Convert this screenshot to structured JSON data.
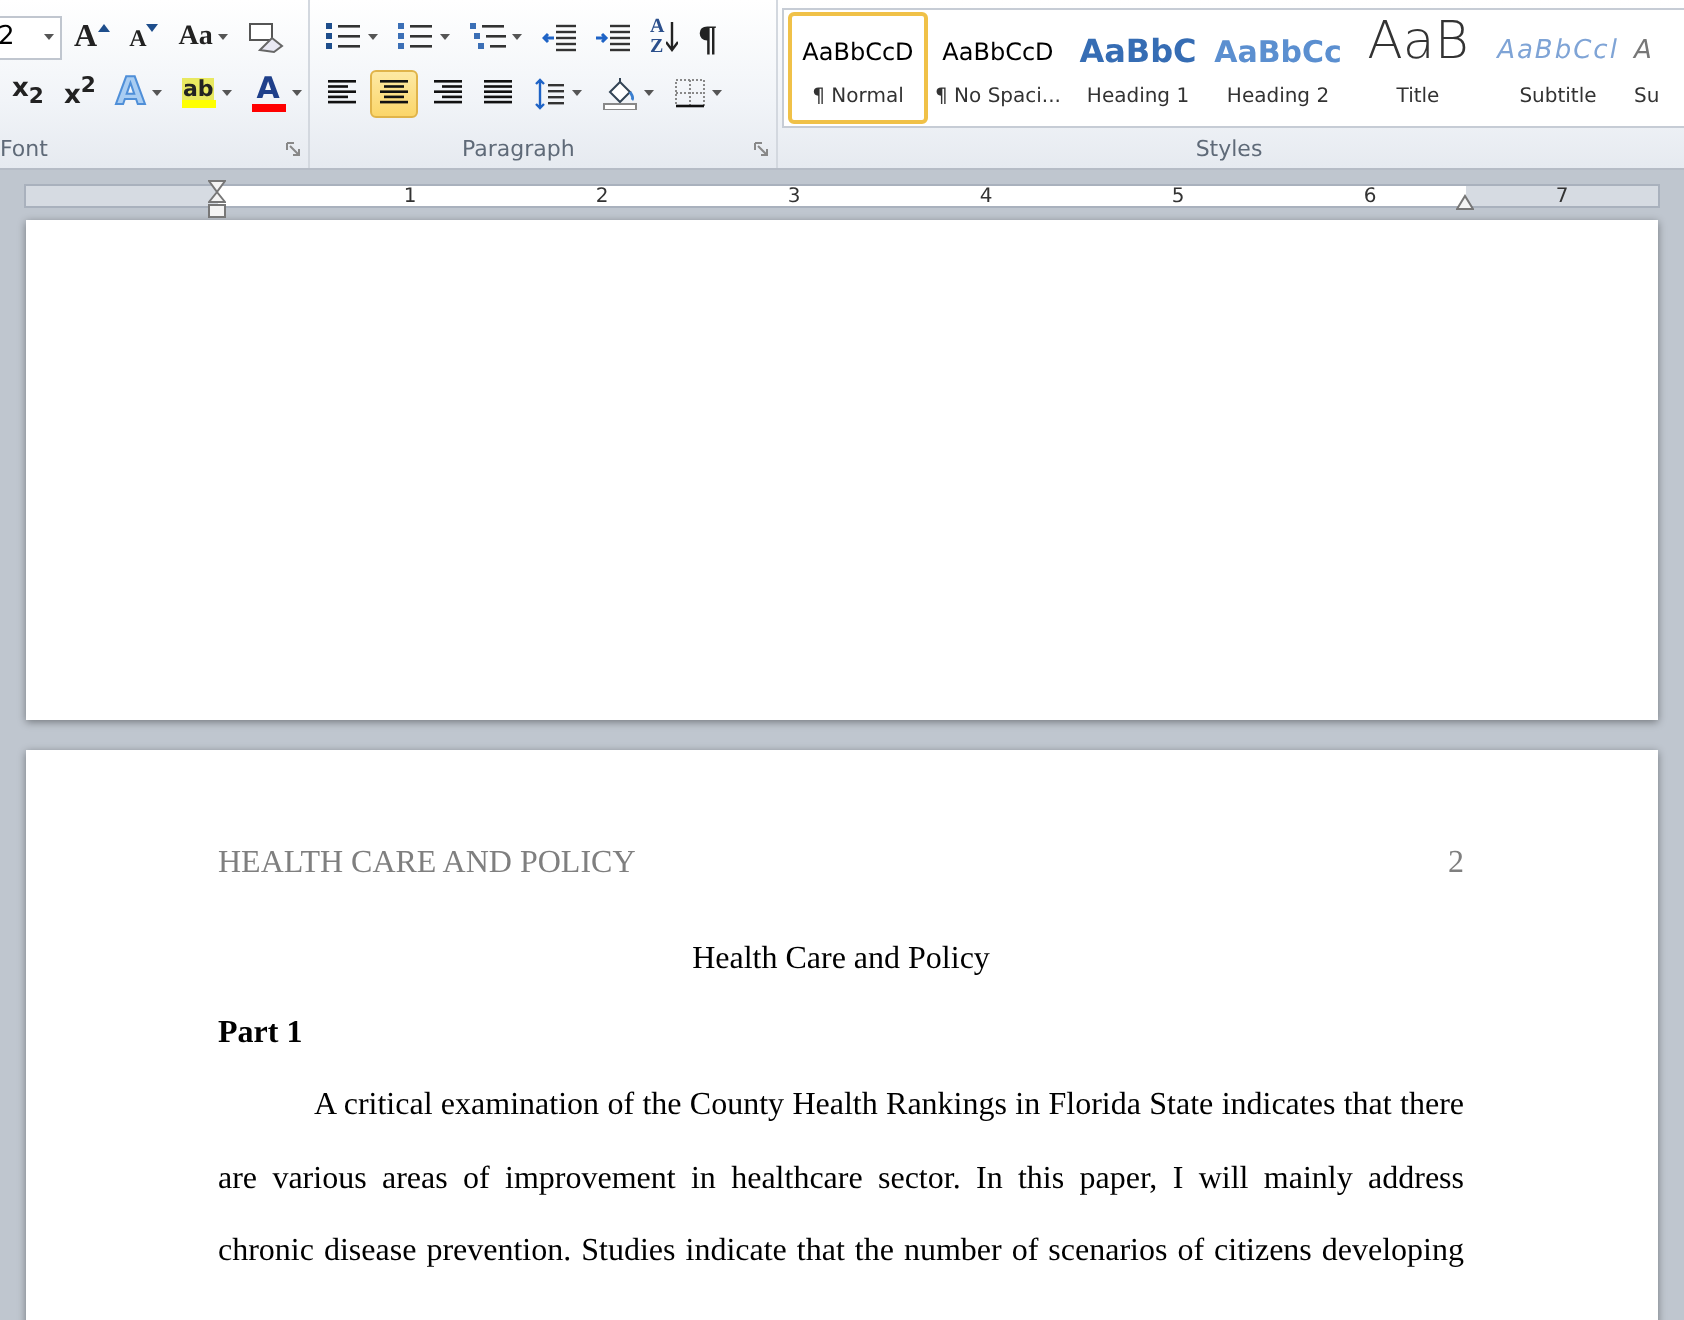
{
  "ribbon": {
    "font_group": {
      "label": "Font",
      "font_size": "2",
      "row_1": [
        {
          "kind": "grow",
          "glyph": "A"
        },
        {
          "kind": "shrink",
          "glyph": "A"
        },
        {
          "kind": "change_case",
          "glyph": "Aa"
        },
        {
          "kind": "clear_formatting"
        }
      ],
      "row_2": [
        {
          "kind": "subscript",
          "glyph": "x$_{2}$"
        },
        {
          "kind": "superscript",
          "glyph": "x$^{2}$"
        },
        {
          "kind": "text_effects",
          "glyph": "A"
        },
        {
          "kind": "highlight",
          "glyph": "ab",
          "color": "#ffff00"
        },
        {
          "kind": "font_color",
          "glyph": "A",
          "color": "#ff0000"
        }
      ]
    },
    "paragraph_group": {
      "label": "Paragraph",
      "row_1": [
        {
          "kind": "bullets"
        },
        {
          "kind": "numbering"
        },
        {
          "kind": "multilevel"
        },
        {
          "kind": "decrease_indent"
        },
        {
          "kind": "increase_indent"
        },
        {
          "kind": "sort",
          "glyph": "A Z"
        },
        {
          "kind": "show_marks",
          "glyph": "¶"
        }
      ],
      "row_2": [
        {
          "kind": "align_left",
          "selected": false
        },
        {
          "kind": "align_center",
          "selected": true
        },
        {
          "kind": "align_right",
          "selected": false
        },
        {
          "kind": "justify",
          "selected": false
        },
        {
          "kind": "line_spacing"
        },
        {
          "kind": "shading"
        },
        {
          "kind": "borders"
        }
      ]
    },
    "styles_group": {
      "label": "Styles",
      "styles": [
        {
          "kind": "normal",
          "sample": "AaBbCcD",
          "name": "¶ Normal",
          "selected": true
        },
        {
          "kind": "no_spacing",
          "sample": "AaBbCcD",
          "name": "¶ No Spaci...",
          "selected": false
        },
        {
          "kind": "heading_1",
          "sample": "AaBbC",
          "name": "Heading 1",
          "selected": false
        },
        {
          "kind": "heading_2",
          "sample": "AaBbCc",
          "name": "Heading 2",
          "selected": false
        },
        {
          "kind": "title",
          "sample": "AaB",
          "name": "Title",
          "selected": false
        },
        {
          "kind": "subtitle",
          "sample": "AaBbCcl",
          "name": "Subtitle",
          "selected": false
        },
        {
          "kind": "subtle",
          "sample": "A",
          "name": "Su",
          "selected": false
        }
      ]
    }
  },
  "ruler": {
    "numbers": [
      "1",
      "2",
      "3",
      "4",
      "5",
      "6",
      "7"
    ]
  },
  "document": {
    "header": "HEALTH CARE AND POLICY",
    "page_number": "2",
    "title": "Health Care and Policy",
    "heading": "Part 1",
    "paragraph": "A critical examination of the County Health Rankings in Florida State indicates that there are various areas of improvement in healthcare sector. In this paper, I will mainly address chronic disease prevention. Studies indicate that the number of scenarios of citizens developing"
  }
}
